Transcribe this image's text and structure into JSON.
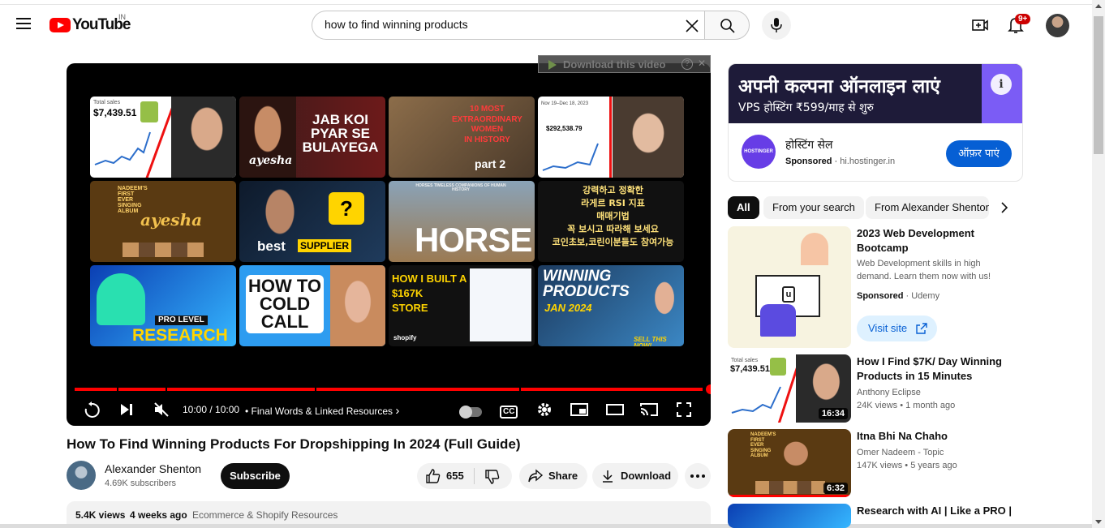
{
  "header": {
    "logo_text": "YouTube",
    "country_code": "IN",
    "search_value": "how to find winning products",
    "notification_count": "9+"
  },
  "player": {
    "download_bar_label": "Download this video",
    "time": "10:00 / 10:00",
    "chapter": "• Final Words & Linked Resources",
    "chapter_arrow": "›",
    "cc_label": "CC",
    "end_screen": [
      {
        "label": "Total sales $7,439.51",
        "text": "$7,439.51",
        "caption": "Total sales"
      },
      {
        "label": "JAB KOI PYAR SE BULAYEGA",
        "text": "JAB KOI\nPYAR SE\nBULAYEGA",
        "signature": "ayesha"
      },
      {
        "label": "10 MOST EXTRAORDINARY WOMEN IN HISTORY part 2",
        "text": "10 MOST\nEXTRAORDINARY\nWOMEN\nIN HISTORY",
        "sub": "part 2"
      },
      {
        "label": "Total sales $292,538.79",
        "text": "$292,538.79",
        "caption": "Nov 19–Dec 18, 2023"
      },
      {
        "label": "Nadeem's first ever singing album ayesha",
        "text": "NADEEM'S\nFIRST\nEVER\nSINGING\nALBUM",
        "signature": "ayesha"
      },
      {
        "label": "best SUPPLIER ?",
        "text": "best",
        "badge": "SUPPLIER"
      },
      {
        "label": "HORSE",
        "text": "HORSE",
        "caption": "HORSES TIMELESS COMPANIONS OF HUMAN HISTORY"
      },
      {
        "label": "강력하고 정확한 라게르 RSI 지표 매매기법",
        "text": "강력하고 정확한\n라게르 RSI 지표\n매매기법\n꼭 보시고 따라해 보세요\n코인초보,코린이분들도 참여가능"
      },
      {
        "label": "PRO LEVEL RESEARCH",
        "text": "RESEARCH",
        "badge": "PRO LEVEL"
      },
      {
        "label": "HOW TO COLD CALL",
        "text": "HOW TO\nCOLD\nCALL"
      },
      {
        "label": "HOW I BUILT A $167K STORE",
        "text": "HOW I BUILT A\n$167K\nSTORE",
        "caption": "shopify"
      },
      {
        "label": "WINNING PRODUCTS JAN 2024",
        "text": "WINNING\nPRODUCTS",
        "sub": "JAN 2024",
        "caption": "SELL THIS NOW!"
      }
    ]
  },
  "video": {
    "title": "How To Find Winning Products For Dropshipping In 2024 (Full Guide)",
    "channel": "Alexander Shenton",
    "subscribers": "4.69K subscribers",
    "subscribe_label": "Subscribe",
    "likes": "655",
    "share_label": "Share",
    "download_label": "Download",
    "views": "5.4K views",
    "uploaded": "4 weeks ago",
    "tags": "Ecommerce & Shopify Resources"
  },
  "ad": {
    "headline": "अपनी कल्पना ऑनलाइन लाएं",
    "subline": "VPS होस्टिंग ₹599/माह से शुरु",
    "title": "होस्टिंग सेल",
    "sponsored": "Sponsored",
    "domain": "hi.hostinger.in",
    "cta": "ऑफ़र पाएं",
    "logo_text": "HOSTINGER"
  },
  "chips": [
    "All",
    "From your search",
    "From Alexander Shenton"
  ],
  "recommendations": [
    {
      "title": "2023 Web Development Bootcamp",
      "desc": "Web Development skills in high demand. Learn them now with us!",
      "sponsored": "Sponsored",
      "advertiser": "· Udemy",
      "cta": "Visit site"
    },
    {
      "title": "How I Find $7K/ Day Winning Products in 15 Minutes",
      "channel": "Anthony Eclipse",
      "meta": "24K views  • 1 month ago",
      "duration": "16:34",
      "thumb_text": "$7,439.51",
      "thumb_caption": "Total sales"
    },
    {
      "title": "Itna Bhi Na Chaho",
      "channel": "Omer Nadeem - Topic",
      "meta": "147K views  • 5 years ago",
      "duration": "6:32",
      "thumb_text": "NADEEM'S FIRST EVER SINGING ALBUM"
    },
    {
      "title": "Research with AI | Like a PRO |"
    }
  ],
  "colors": {
    "brand_red": "#ff0000",
    "cta_blue": "#065fd4",
    "hostinger_purple": "#673de6"
  }
}
